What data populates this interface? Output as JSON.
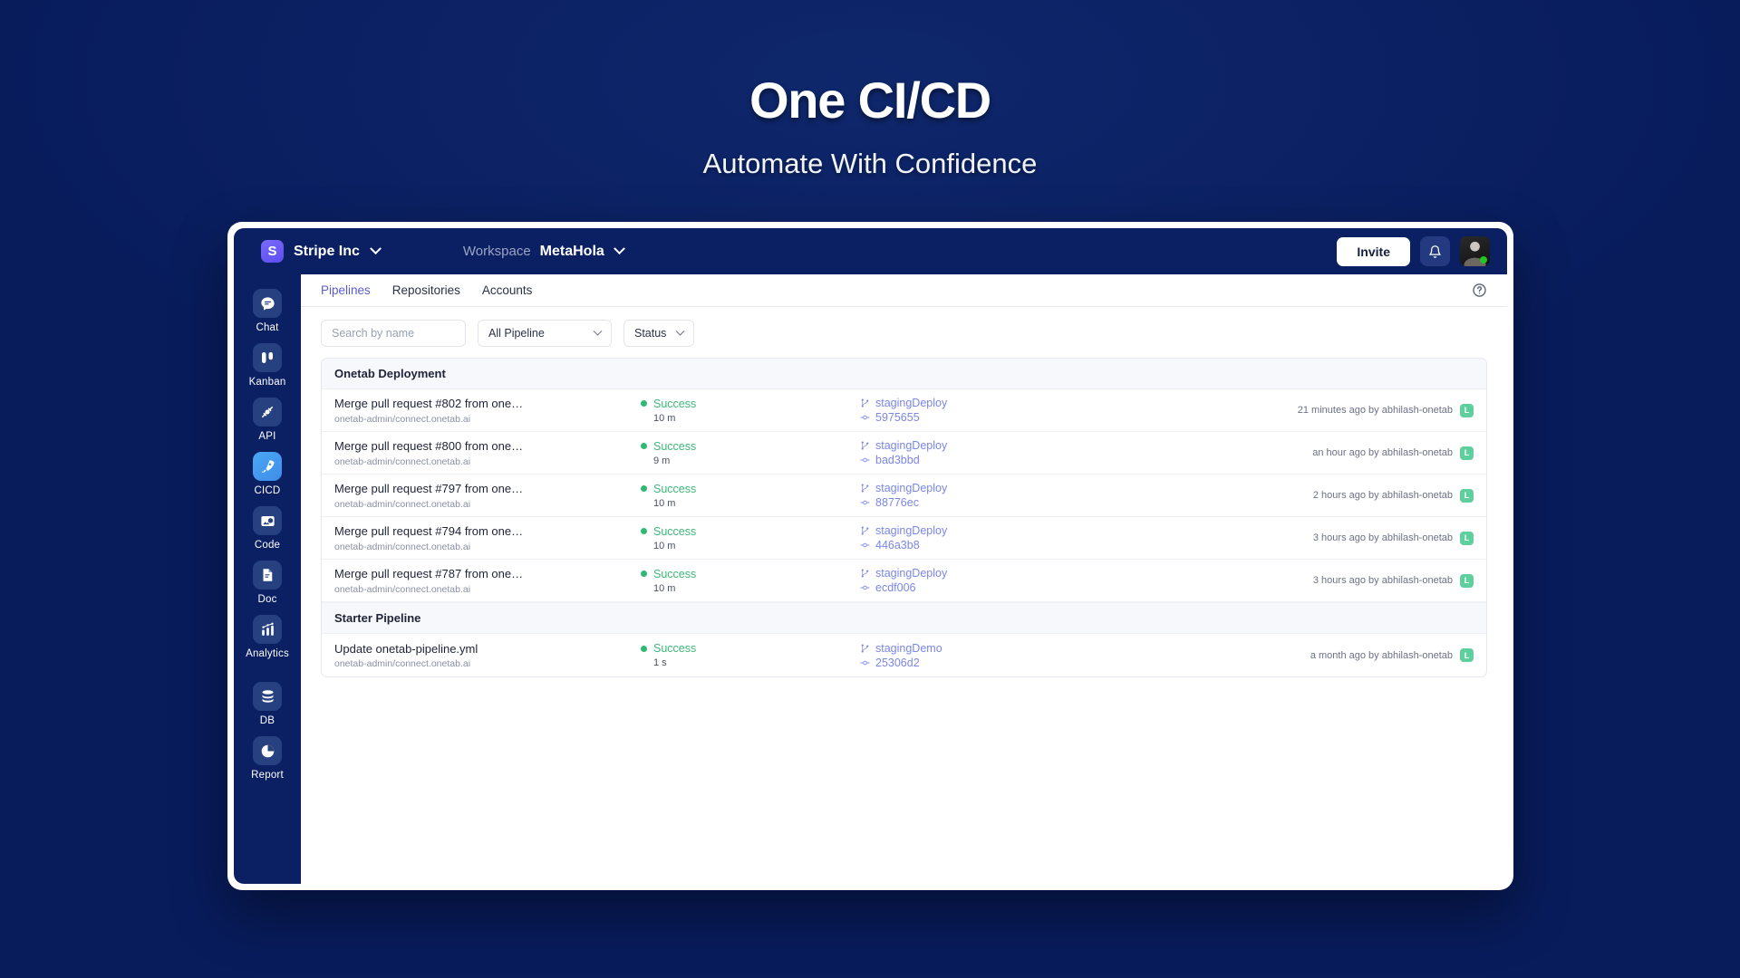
{
  "hero": {
    "title": "One CI/CD",
    "subtitle": "Automate With Confidence"
  },
  "colors": {
    "page_background": "#081c5c",
    "app_chrome": "#0b1f63",
    "accent_purple": "#5b5bd6",
    "brand_logo": "#6b5bf5",
    "success_green": "#3cb878",
    "success_dot": "#2eb872",
    "branch_link": "#7b86e8",
    "active_nav": "#4aa7f5",
    "author_badge": "#5fcf9e",
    "presence_online": "#22c522"
  },
  "topbar": {
    "logo_letter": "S",
    "logo_icon": "stripe-logo-icon",
    "org_name": "Stripe Inc",
    "org_chevron_icon": "chevron-down-icon",
    "workspace_label": "Workspace",
    "workspace_value": "MetaHola",
    "workspace_chevron_icon": "chevron-down-icon",
    "invite_label": "Invite",
    "bell_icon": "bell-icon",
    "avatar_icon": "user-avatar",
    "presence_icon": "online-status-dot"
  },
  "sidebar": {
    "items": [
      {
        "label": "Chat",
        "icon": "chat-bubble-icon",
        "active": false
      },
      {
        "label": "Kanban",
        "icon": "kanban-board-icon",
        "active": false
      },
      {
        "label": "API",
        "icon": "api-plug-icon",
        "active": false
      },
      {
        "label": "CICD",
        "icon": "rocket-icon",
        "active": true
      },
      {
        "label": "Code",
        "icon": "code-window-icon",
        "active": false
      },
      {
        "label": "Doc",
        "icon": "document-icon",
        "active": false
      },
      {
        "label": "Analytics",
        "icon": "bar-chart-icon",
        "active": false
      },
      {
        "label": "DB",
        "icon": "database-icon",
        "active": false
      },
      {
        "label": "Report",
        "icon": "pie-chart-icon",
        "active": false
      }
    ]
  },
  "tabs": [
    {
      "label": "Pipelines",
      "active": true
    },
    {
      "label": "Repositories",
      "active": false
    },
    {
      "label": "Accounts",
      "active": false
    }
  ],
  "help_icon": "help-circle-icon",
  "filters": {
    "search_placeholder": "Search by name",
    "search_value": "",
    "pipeline_select_value": "All Pipeline",
    "status_select_value": "Status",
    "chevron_icon": "chevron-down-icon"
  },
  "groups": [
    {
      "title": "Onetab Deployment",
      "rows": [
        {
          "name": "Merge pull request #802 from one…",
          "repo": "onetab-admin/connect.onetab.ai",
          "status": "Success",
          "duration": "10 m",
          "branch": "stagingDeploy",
          "commit": "5975655",
          "timestamp": "21 minutes ago by abhilash-onetab",
          "author_initial": "L",
          "branch_icon": "git-branch-icon",
          "commit_icon": "git-commit-icon"
        },
        {
          "name": "Merge pull request #800 from one…",
          "repo": "onetab-admin/connect.onetab.ai",
          "status": "Success",
          "duration": "9 m",
          "branch": "stagingDeploy",
          "commit": "bad3bbd",
          "timestamp": "an hour ago by abhilash-onetab",
          "author_initial": "L",
          "branch_icon": "git-branch-icon",
          "commit_icon": "git-commit-icon"
        },
        {
          "name": "Merge pull request #797 from one…",
          "repo": "onetab-admin/connect.onetab.ai",
          "status": "Success",
          "duration": "10 m",
          "branch": "stagingDeploy",
          "commit": "88776ec",
          "timestamp": "2 hours ago by abhilash-onetab",
          "author_initial": "L",
          "branch_icon": "git-branch-icon",
          "commit_icon": "git-commit-icon"
        },
        {
          "name": "Merge pull request #794 from one…",
          "repo": "onetab-admin/connect.onetab.ai",
          "status": "Success",
          "duration": "10 m",
          "branch": "stagingDeploy",
          "commit": "446a3b8",
          "timestamp": "3 hours ago by abhilash-onetab",
          "author_initial": "L",
          "branch_icon": "git-branch-icon",
          "commit_icon": "git-commit-icon"
        },
        {
          "name": "Merge pull request #787 from one…",
          "repo": "onetab-admin/connect.onetab.ai",
          "status": "Success",
          "duration": "10 m",
          "branch": "stagingDeploy",
          "commit": "ecdf006",
          "timestamp": "3 hours ago by abhilash-onetab",
          "author_initial": "L",
          "branch_icon": "git-branch-icon",
          "commit_icon": "git-commit-icon"
        }
      ]
    },
    {
      "title": "Starter Pipeline",
      "rows": [
        {
          "name": "Update onetab-pipeline.yml",
          "repo": "onetab-admin/connect.onetab.ai",
          "status": "Success",
          "duration": "1 s",
          "branch": "stagingDemo",
          "commit": "25306d2",
          "timestamp": "a month ago by abhilash-onetab",
          "author_initial": "L",
          "branch_icon": "git-branch-icon",
          "commit_icon": "git-commit-icon"
        }
      ]
    }
  ]
}
